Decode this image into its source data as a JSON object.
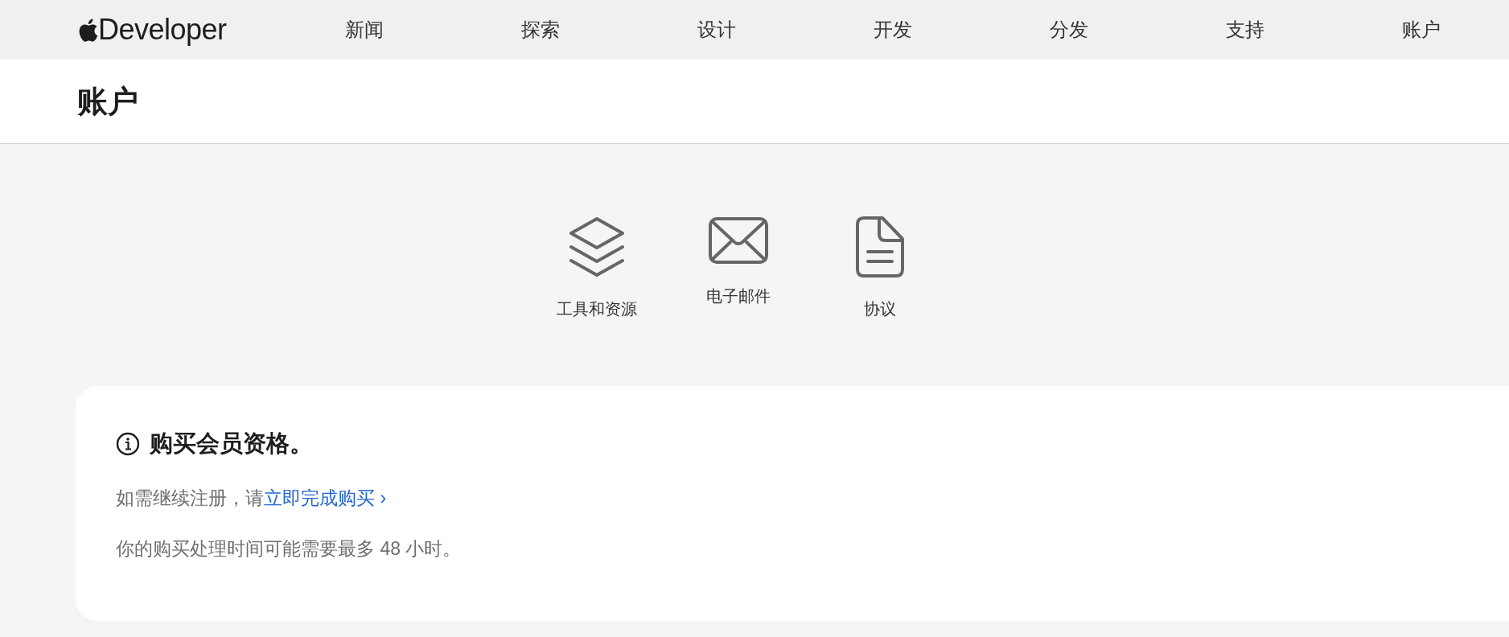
{
  "header": {
    "brand": "Developer",
    "nav": [
      "新闻",
      "探索",
      "设计",
      "开发",
      "分发",
      "支持",
      "账户"
    ]
  },
  "page_title": "账户",
  "shortcuts": [
    {
      "kind": "layers",
      "label": "工具和资源"
    },
    {
      "kind": "mail",
      "label": "电子邮件"
    },
    {
      "kind": "document",
      "label": "协议"
    }
  ],
  "notice": {
    "title": "购买会员资格。",
    "text": "如需继续注册，请",
    "link": "立即完成购买 ›",
    "note": "你的购买处理时间可能需要最多 48 小时。"
  }
}
